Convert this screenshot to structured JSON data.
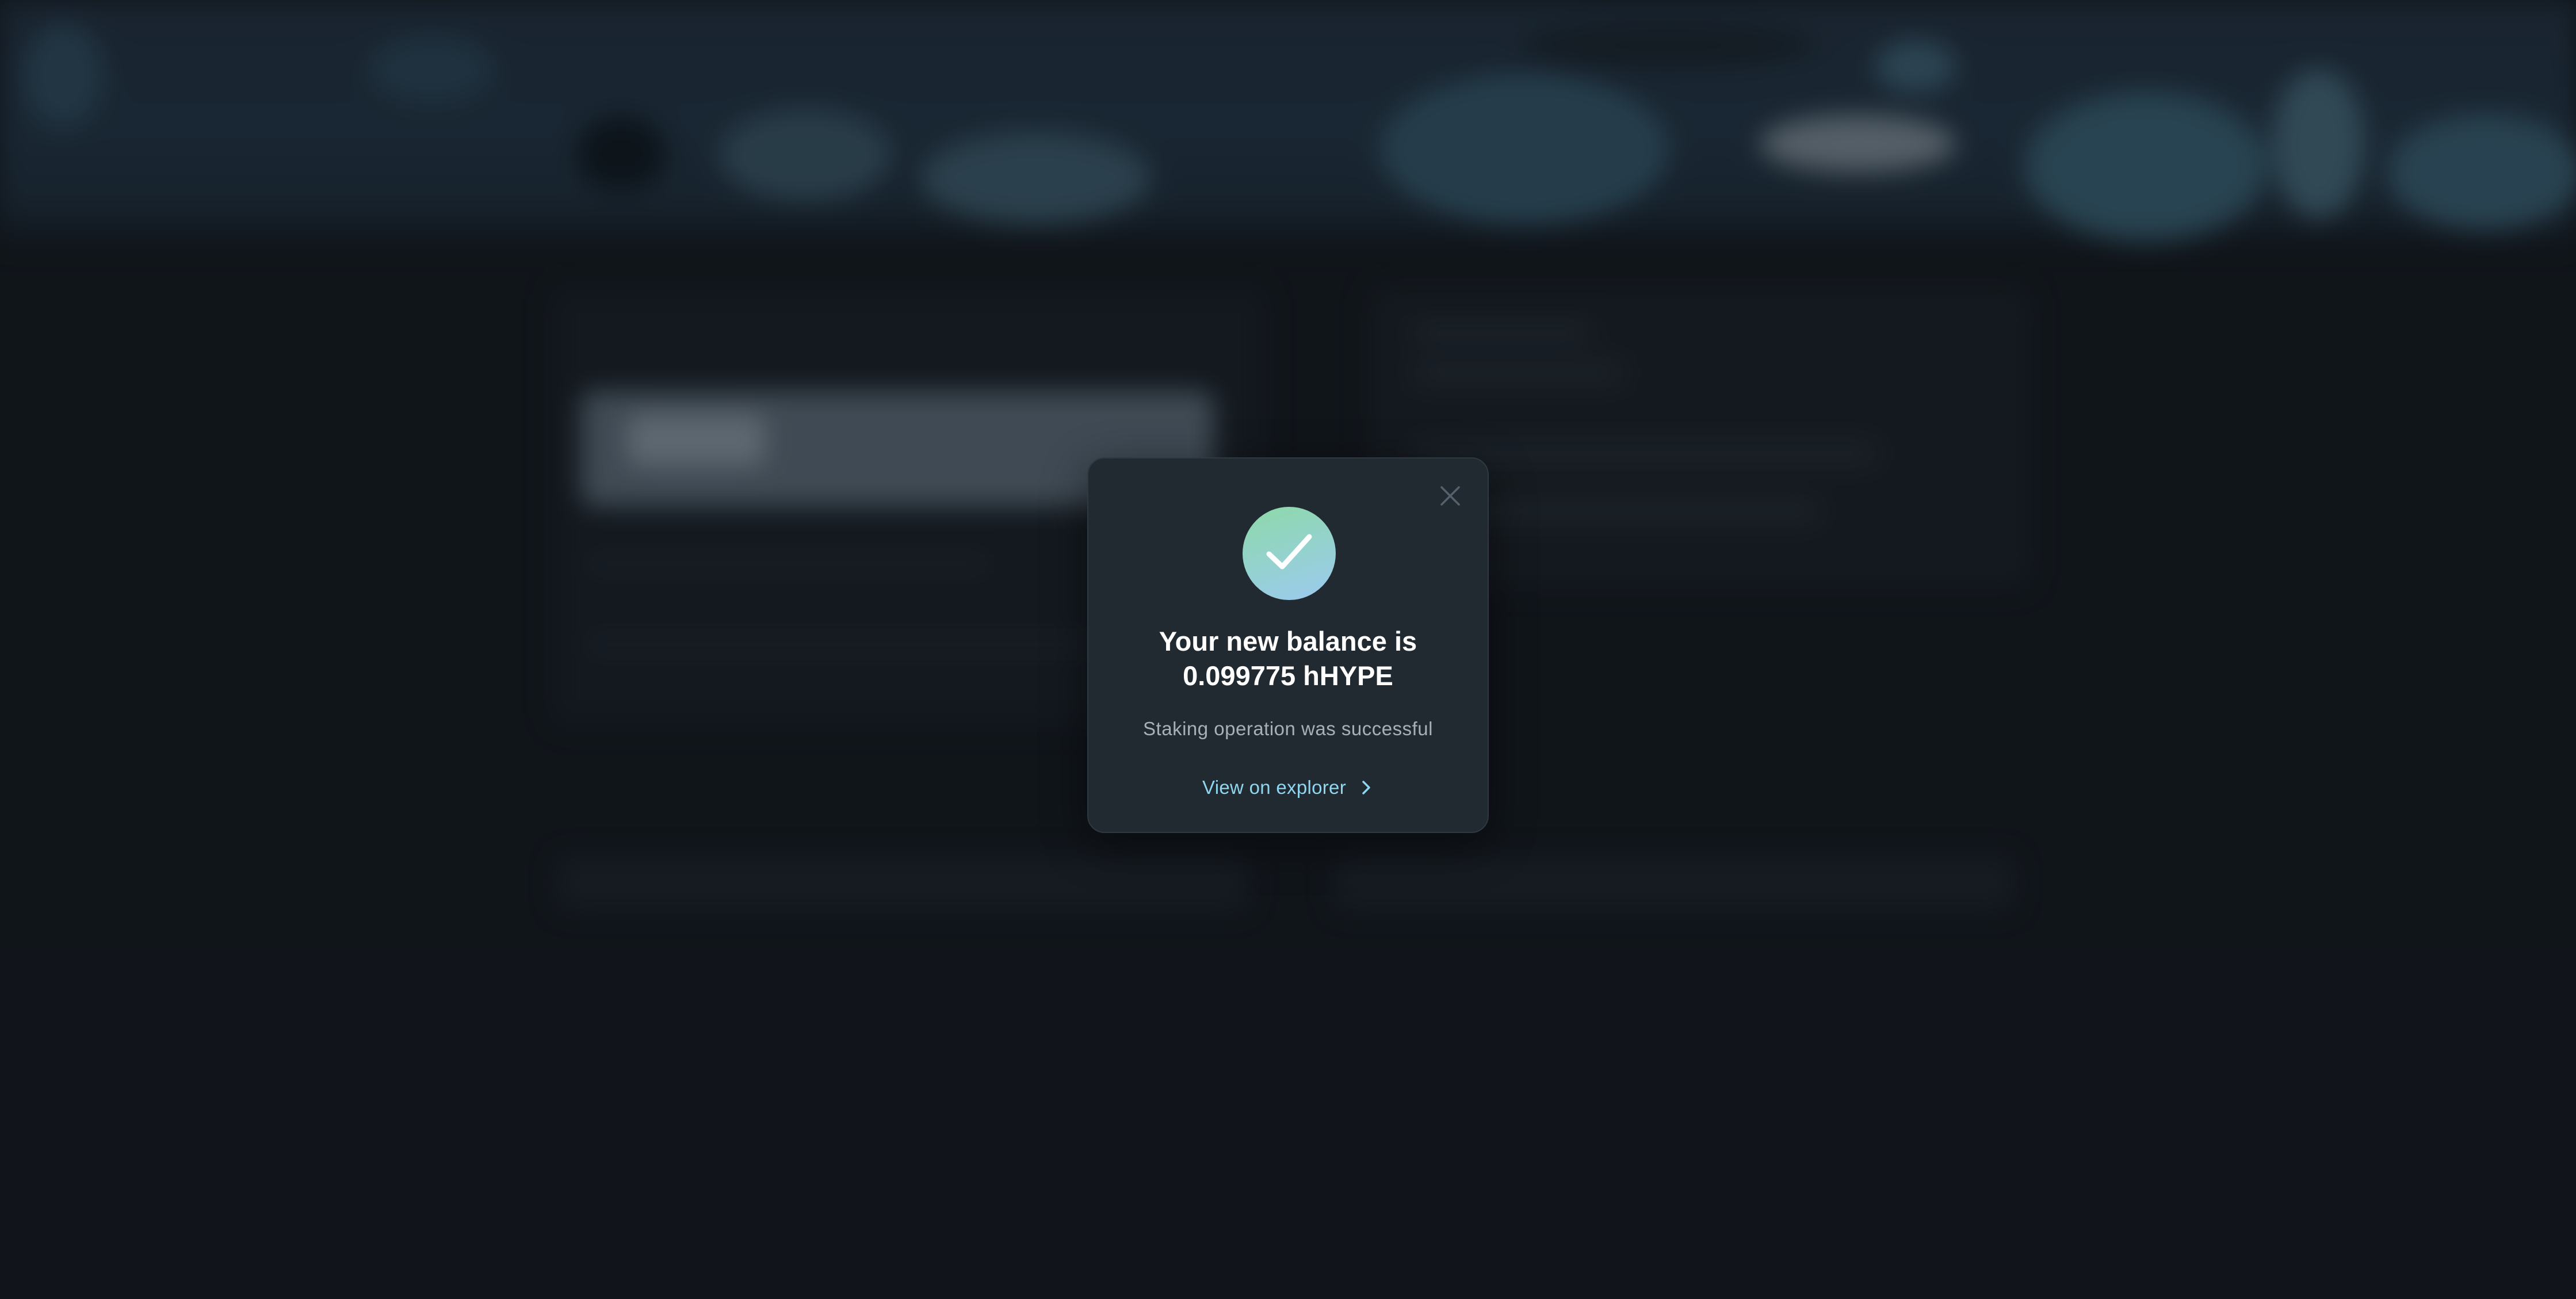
{
  "modal": {
    "title_line1": "Your new balance is",
    "title_line2": "0.099775 hHYPE",
    "subtitle": "Staking operation was successful",
    "link_label": "View on explorer",
    "success_icon": "checkmark-icon",
    "close_icon": "close-icon",
    "link_icon": "chevron-right-icon",
    "colors": {
      "background": "#222a31",
      "title": "#ffffff",
      "subtitle": "#a7b0b8",
      "link": "#8fd6f0",
      "badge_gradient_start": "#8ed9a8",
      "badge_gradient_end": "#9ccaf0"
    }
  }
}
